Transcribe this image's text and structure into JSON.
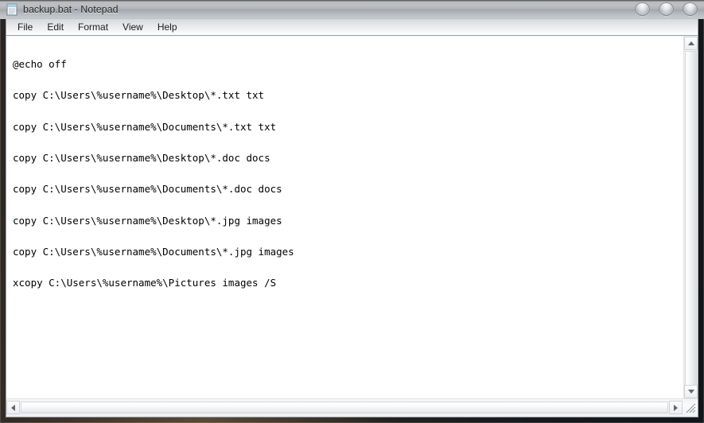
{
  "window": {
    "title": "backup.bat - Notepad",
    "app_icon": "notepad-icon",
    "caption": {
      "minimize_label": "",
      "maximize_label": "",
      "close_label": ""
    }
  },
  "menubar": {
    "items": [
      {
        "label": "File"
      },
      {
        "label": "Edit"
      },
      {
        "label": "Format"
      },
      {
        "label": "View"
      },
      {
        "label": "Help"
      }
    ]
  },
  "editor": {
    "lines": [
      "@echo off",
      "copy C:\\Users\\%username%\\Desktop\\*.txt txt",
      "copy C:\\Users\\%username%\\Documents\\*.txt txt",
      "copy C:\\Users\\%username%\\Desktop\\*.doc docs",
      "copy C:\\Users\\%username%\\Documents\\*.doc docs",
      "copy C:\\Users\\%username%\\Desktop\\*.jpg images",
      "copy C:\\Users\\%username%\\Documents\\*.jpg images",
      "xcopy C:\\Users\\%username%\\Pictures images /S"
    ]
  },
  "scrollbars": {
    "vertical": {
      "up_icon": "arrow-up-icon",
      "down_icon": "arrow-down-icon"
    },
    "horizontal": {
      "left_icon": "arrow-left-icon",
      "right_icon": "arrow-right-icon"
    },
    "resize_grip": "resize-grip-icon"
  },
  "colors": {
    "editor_background": "#ffffff",
    "editor_text": "#000000",
    "menubar_text": "#1b1b1b",
    "title_text": "#2b2b2b"
  }
}
